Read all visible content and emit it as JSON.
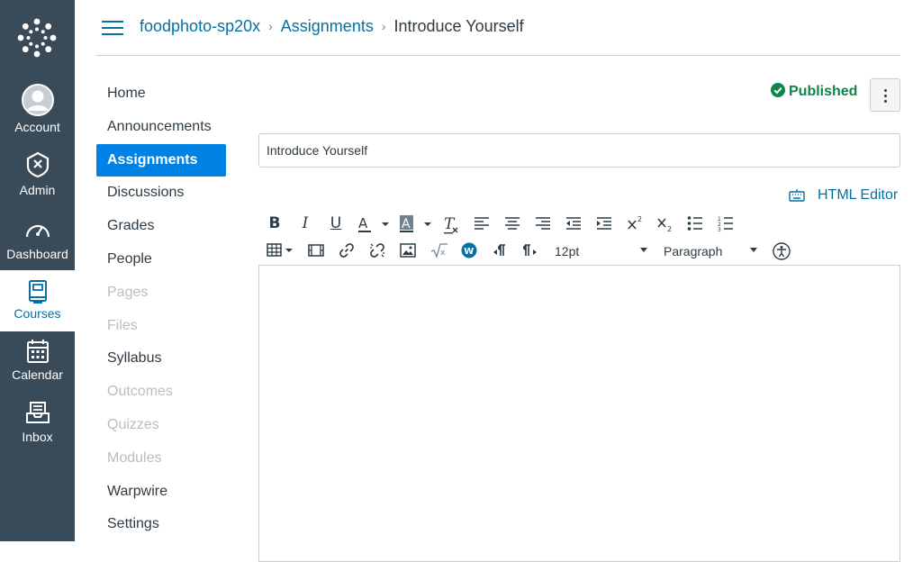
{
  "global_nav": {
    "items": [
      {
        "label": "Account",
        "icon": "avatar-icon"
      },
      {
        "label": "Admin",
        "icon": "shield-icon"
      },
      {
        "label": "Dashboard",
        "icon": "dashboard-icon"
      },
      {
        "label": "Courses",
        "icon": "book-icon"
      },
      {
        "label": "Calendar",
        "icon": "calendar-icon"
      },
      {
        "label": "Inbox",
        "icon": "inbox-icon"
      }
    ]
  },
  "breadcrumb": {
    "course": "foodphoto-sp20x",
    "section": "Assignments",
    "current": "Introduce Yourself",
    "separator": "›"
  },
  "course_nav": {
    "items": [
      {
        "label": "Home"
      },
      {
        "label": "Announcements"
      },
      {
        "label": "Assignments"
      },
      {
        "label": "Discussions"
      },
      {
        "label": "Grades"
      },
      {
        "label": "People"
      },
      {
        "label": "Pages"
      },
      {
        "label": "Files"
      },
      {
        "label": "Syllabus"
      },
      {
        "label": "Outcomes"
      },
      {
        "label": "Quizzes"
      },
      {
        "label": "Modules"
      },
      {
        "label": "Warpwire"
      },
      {
        "label": "Settings"
      }
    ]
  },
  "status": {
    "label": "Published",
    "color": "#0b874b"
  },
  "assignment": {
    "title_value": "Introduce Yourself"
  },
  "editor": {
    "html_editor_label": "HTML Editor",
    "font_size": "12pt",
    "block_format": "Paragraph"
  },
  "colors": {
    "nav_bg": "#394b58",
    "link": "#0770a3",
    "active_nav": "#0081e4"
  }
}
